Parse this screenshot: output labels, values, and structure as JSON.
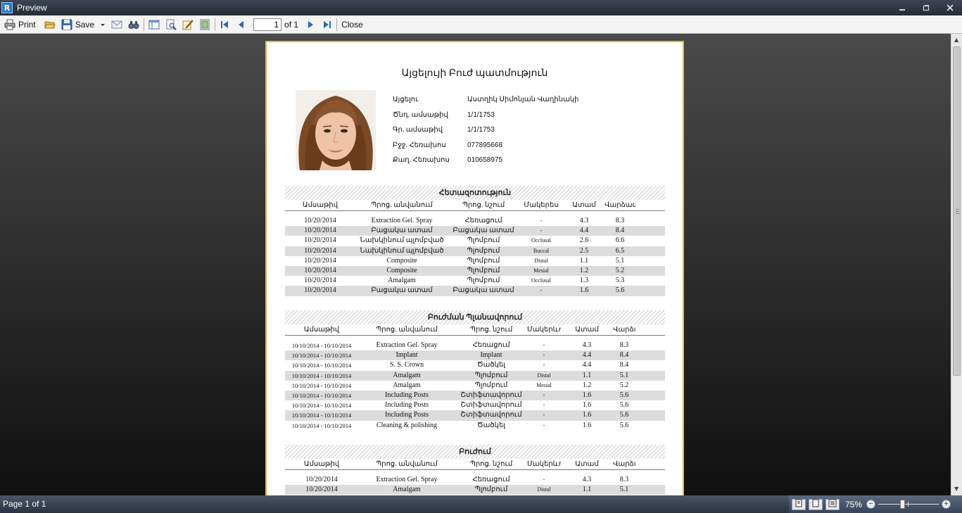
{
  "window": {
    "title": "Preview",
    "app_icon_letter": "R"
  },
  "toolbar": {
    "print_label": "Print",
    "save_label": "Save",
    "page_value": "1",
    "page_of": "of 1",
    "close_label": "Close"
  },
  "report": {
    "title": "Այցելույի Բուժ պատմություն",
    "patient": [
      {
        "key": "Այցելու",
        "value": "Աստղիկ  Սիմոնյան Վաղինակի"
      },
      {
        "key": "Ծնդ. ամսաթիվ",
        "value": "1/1/1753"
      },
      {
        "key": "Գր. ամսաթիվ",
        "value": "1/1/1753"
      },
      {
        "key": "Բջջ. Հեռախոս",
        "value": "077895668"
      },
      {
        "key": "Քաղ. Հեռախոս",
        "value": "010658975"
      }
    ],
    "sections": [
      {
        "title": "Հետազոտություն",
        "columns": [
          "Ամսաթիվ",
          "Պրոց. անվանում",
          "Պրոց. նշում",
          "Մակերես",
          "Ատամ",
          "Վարձատրում"
        ],
        "rows": [
          [
            "10/20/2014",
            "Extraction Gel. Spray",
            "Հեռացում",
            "-",
            "4.3",
            "8.3"
          ],
          [
            "10/20/2014",
            "Բացակա ատամ",
            "Բացակա ատամ",
            "-",
            "4.4",
            "8.4"
          ],
          [
            "10/20/2014",
            "Նախկինում պլոմբված",
            "Պլոմբում",
            "Occlusal",
            "2.6",
            "6.6"
          ],
          [
            "10/20/2014",
            "Նախկինում պլոմբված",
            "Պլոմբում",
            "Buccal",
            "2.5",
            "6.5"
          ],
          [
            "10/20/2014",
            "Composite",
            "Պլոմբում",
            "Distal",
            "1.1",
            "5.1"
          ],
          [
            "10/20/2014",
            "Composite",
            "Պլոմբում",
            "Mesial",
            "1.2",
            "5.2"
          ],
          [
            "10/20/2014",
            "Amalgam",
            "Պլոմբում",
            "Occlusal",
            "1.3",
            "5.3"
          ],
          [
            "10/20/2014",
            "Բացակա ատամ",
            "Բացակա ատամ",
            "-",
            "1.6",
            "5.6"
          ]
        ]
      },
      {
        "title": "Բուժման Պլանավորում",
        "columns": [
          "Ամսաթիվ",
          "Պրոց. անվանում",
          "Պրոց. նշում",
          "Մակերևույթ",
          "Ատամ",
          "Վարձատրում"
        ],
        "rows": [
          [
            "10/10/2014 - 10/10/2014",
            "Extraction Gel. Spray",
            "Հեռացում",
            "-",
            "4.3",
            "8.3"
          ],
          [
            "10/10/2014 - 10/10/2014",
            "Implant",
            "Implant",
            "-",
            "4.4",
            "8.4"
          ],
          [
            "10/10/2014 - 10/10/2014",
            "S. S. Crown",
            "Ծածկել",
            "-",
            "4.4",
            "8.4"
          ],
          [
            "10/10/2014 - 10/10/2014",
            "Amalgam",
            "Պլոմբում",
            "Distal",
            "1.1",
            "5.1"
          ],
          [
            "10/10/2014 - 10/10/2014",
            "Amalgam",
            "Պլոմբում",
            "Mesial",
            "1.2",
            "5.2"
          ],
          [
            "10/10/2014 - 10/10/2014",
            "Including Posts",
            "Շտիֆտավորում",
            "-",
            "1.6",
            "5.6"
          ],
          [
            "10/10/2014 - 10/10/2014",
            "Including Posts",
            "Շտիֆտավորում",
            "-",
            "1.6",
            "5.6"
          ],
          [
            "10/10/2014 - 10/10/2014",
            "Including Posts",
            "Շտիֆտավորում",
            "-",
            "1.6",
            "5.6"
          ],
          [
            "10/10/2014 - 10/10/2014",
            "Cleaning & polishing",
            "Ծածկել",
            "-",
            "1.6",
            "5.6"
          ]
        ]
      },
      {
        "title": "Բուժում",
        "columns": [
          "Ամսաթիվ",
          "Պրոց. անվանում",
          "Պրոց. նշում",
          "Մակերևույթ",
          "Ատամ",
          "Վարձատրում"
        ],
        "rows": [
          [
            "10/20/2014",
            "Extraction Gel. Spray",
            "Հեռացում",
            "-",
            "4.3",
            "8.3"
          ],
          [
            "10/20/2014",
            "Amalgam",
            "Պլոմբում",
            "Distal",
            "1.1",
            "5.1"
          ]
        ]
      }
    ]
  },
  "status": {
    "page_text": "Page 1 of 1",
    "zoom": "75%"
  }
}
